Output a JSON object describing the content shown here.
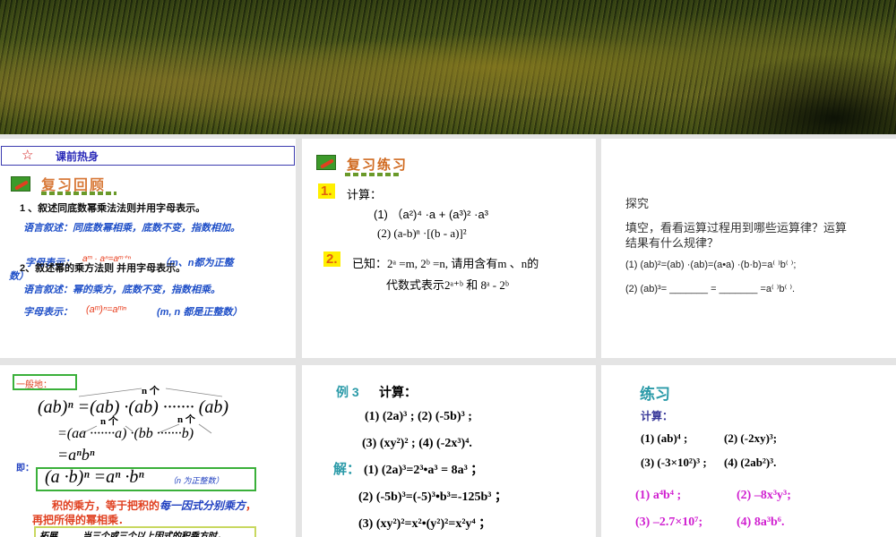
{
  "slide1": {
    "star": "☆",
    "header": "课前热身",
    "title": "复习回顾",
    "q1": "1 、叙述同底数幂乘法法则并用字母表示。",
    "q1_verbal": "语言叙述：同底数幂相乘，底数不变，指数相加。",
    "q1_letter": "字母表示：",
    "q1_formula": "aᵐ · aⁿ=aᵐ⁺ⁿ",
    "q1_note": "（m、n都为正整",
    "q1_note2": "数）",
    "q2": "2、叙述幂的乘方法则 并用字母表示。",
    "q2_verbal": "语言叙述：幂的乘方，底数不变，指数相乘。",
    "q2_letter": "字母表示：",
    "q2_formula": "(aᵐ)ⁿ=aᵐⁿ",
    "q2_note": "(m, n 都是正整数）"
  },
  "slide2": {
    "title": "复习练习",
    "num1": "1.",
    "calc": "计算：",
    "e1": "(1) （a²)⁴ ·a + (a³)² ·a³",
    "e2": "(2)   (a-b)ⁿ ·[(b - a)]²",
    "num2": "2.",
    "given": "已知：2ᵃ =m,  2ᵇ =n,  请用含有m 、n的",
    "given2": "代数式表示2ᵃ⁺ᵇ    和    8ᵃ - 2ᵇ"
  },
  "slide3": {
    "title": "探究",
    "question": "填空，看看运算过程用到哪些运算律？运算",
    "question2": "结果有什么规律？",
    "l1": "(1)  (ab)²=(ab) ·(ab)=(a•a) ·(b·b)=a⁽ ⁾b⁽ ⁾;",
    "l2": "(2)   (ab)³= _______  =   _______ =a⁽ ⁾b⁽ ⁾."
  },
  "slide4": {
    "label": "一般地：",
    "n_ge": "n 个",
    "l1": "(ab)ⁿ =(ab) ·(ab) ······· (ab)",
    "l2": "=(aa ·······a) ·(bb ·······b)",
    "l3": "=aⁿbⁿ",
    "ji": "即：",
    "formula": "(a ·b)ⁿ =aⁿ ·bⁿ",
    "formula_note": "（n 为正整数）",
    "rule_a": "积的乘方，等于把积的",
    "rule_b": "每一因式分别乘方",
    "rule_c": "，",
    "rule2": "再把所得的幂相乘．",
    "ext_label": "拓展",
    "ext_text": "当三个或三个以上因式的积乘方时，"
  },
  "slide5": {
    "ex": "例 3",
    "calc": "计算：",
    "p1": "(1)  (2a)³ ;      (2)  (-5b)³ ;",
    "p2": "(3)  (xy²)² ;     (4)  (-2x³)⁴.",
    "sol": "解：",
    "s1": "(1)  (2a)³=2³•a³ = 8a³ ；",
    "s2": "(2)  (-5b)³=(-5)³•b³=-125b³ ；",
    "s3": "(3)  (xy²)²=x²•(y²)²=x²y⁴ ；"
  },
  "slide6": {
    "title": "练习",
    "calc": "计算：",
    "p1a": "(1) (ab)⁴ ;",
    "p1b": "(2)  (-2xy)³;",
    "p2a": "(3) (-3×10²)³ ;",
    "p2b": "(4)  (2ab²)³.",
    "a1": "(1)  a⁴b⁴ ;",
    "a2": "(2)  –8x³y³;",
    "a3": "(3)  –2.7×10⁷;",
    "a4": "(4)  8a³b⁶."
  }
}
